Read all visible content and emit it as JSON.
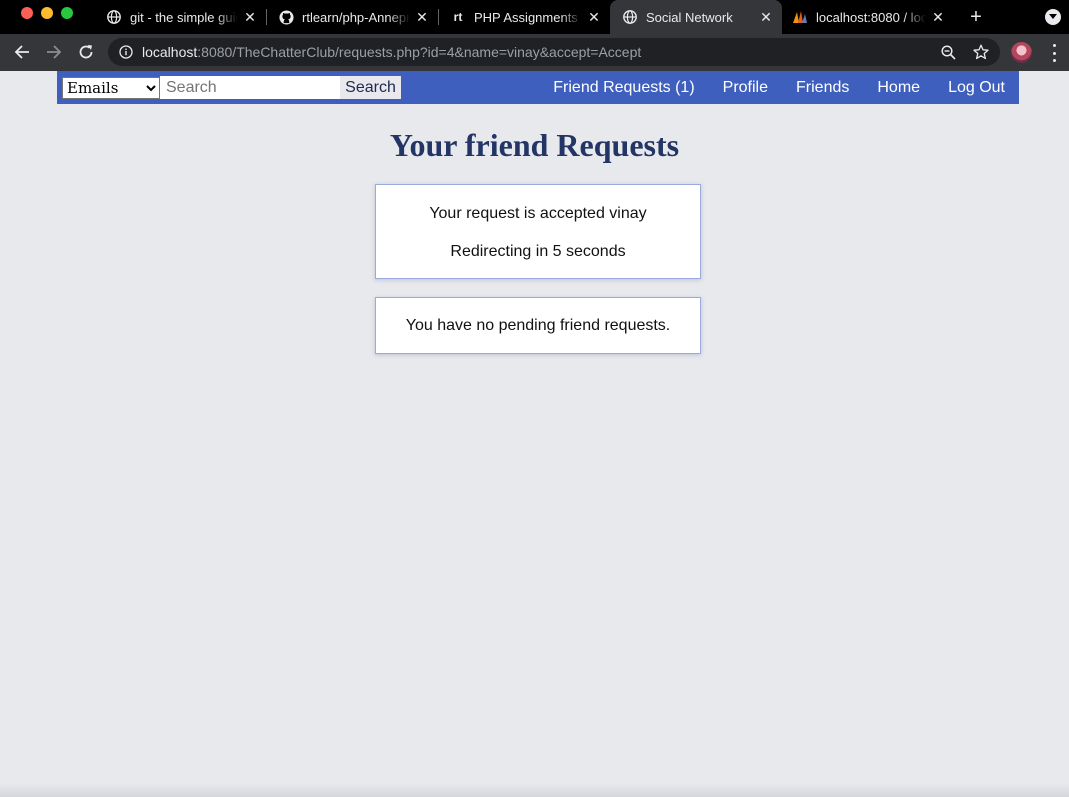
{
  "browser": {
    "tabs": [
      {
        "title": "git - the simple guide",
        "favicon": "globe-icon",
        "active": false
      },
      {
        "title": "rtlearn/php-Anneprogram",
        "favicon": "github-icon",
        "active": false
      },
      {
        "title": "PHP Assignments - rtlearn",
        "favicon": "rt",
        "active": false
      },
      {
        "title": "Social Network",
        "favicon": "globe-icon",
        "active": true
      },
      {
        "title": "localhost:8080 / localhost",
        "favicon": "phpmyadmin-icon",
        "active": false
      }
    ],
    "url_host": "localhost",
    "url_rest": ":8080/TheChatterClub/requests.php?id=4&name=vinay&accept=Accept"
  },
  "navbar": {
    "select_value": "Emails",
    "select_options": [
      "Emails"
    ],
    "search_placeholder": "Search",
    "search_button": "Search",
    "links": {
      "friend_requests": "Friend Requests (1)",
      "profile": "Profile",
      "friends": "Friends",
      "home": "Home",
      "logout": "Log Out"
    }
  },
  "main": {
    "title": "Your friend Requests",
    "status": {
      "message": "Your request is accepted vinay",
      "redirect": "Redirecting in 5 seconds"
    },
    "empty_message": "You have no pending friend requests."
  },
  "colors": {
    "navbar": "#3e5fbd",
    "page_background": "#e8e9ed",
    "title": "#233565"
  }
}
